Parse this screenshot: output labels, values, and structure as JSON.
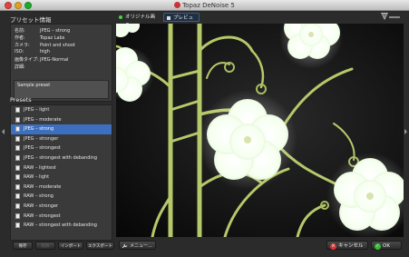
{
  "window": {
    "title": "Topaz DeNoise 5"
  },
  "info": {
    "header": "プリセット情報",
    "rows": [
      {
        "key": "名前:",
        "value": "JPEG – strong"
      },
      {
        "key": "作者:",
        "value": "Topaz Labs"
      },
      {
        "key": "カメラ:",
        "value": "Point and shoot"
      },
      {
        "key": "ISO:",
        "value": "high"
      },
      {
        "key": "画像タイプ:",
        "value": "JPEG-Normal"
      },
      {
        "key": "詳細:",
        "value": ""
      }
    ],
    "description": "Sample preset"
  },
  "presets": {
    "header": "Presets",
    "items": [
      {
        "label": "JPEG – light",
        "selected": false
      },
      {
        "label": "JPEG – moderate",
        "selected": false
      },
      {
        "label": "JPEG – strong",
        "selected": true
      },
      {
        "label": "JPEG – stronger",
        "selected": false
      },
      {
        "label": "JPEG – strongest",
        "selected": false
      },
      {
        "label": "JPEG – strongest with debanding",
        "selected": false
      },
      {
        "label": "RAW – lightest",
        "selected": false
      },
      {
        "label": "RAW – light",
        "selected": false
      },
      {
        "label": "RAW – moderate",
        "selected": false
      },
      {
        "label": "RAW – strong",
        "selected": false
      },
      {
        "label": "RAW – stronger",
        "selected": false
      },
      {
        "label": "RAW – strongest",
        "selected": false
      },
      {
        "label": "RAW – strongest with debanding",
        "selected": false
      }
    ]
  },
  "left_buttons": {
    "save": "保存",
    "delete": "削除",
    "import": "インポート",
    "export": "エクスポート"
  },
  "tabs": {
    "original": "オリジナル画像",
    "preview": "プレビュー"
  },
  "bottom": {
    "menu": "メニュー...",
    "cancel": "キャンセル",
    "ok": "OK"
  },
  "colors": {
    "selection": "#3d6fbf",
    "original_dot": "#48d048",
    "cancel_icon": "#dd3333",
    "ok_icon": "#33bb33"
  },
  "icons": [
    "close-icon",
    "wrench-icon",
    "check-icon",
    "document-icon",
    "topaz-logo"
  ]
}
